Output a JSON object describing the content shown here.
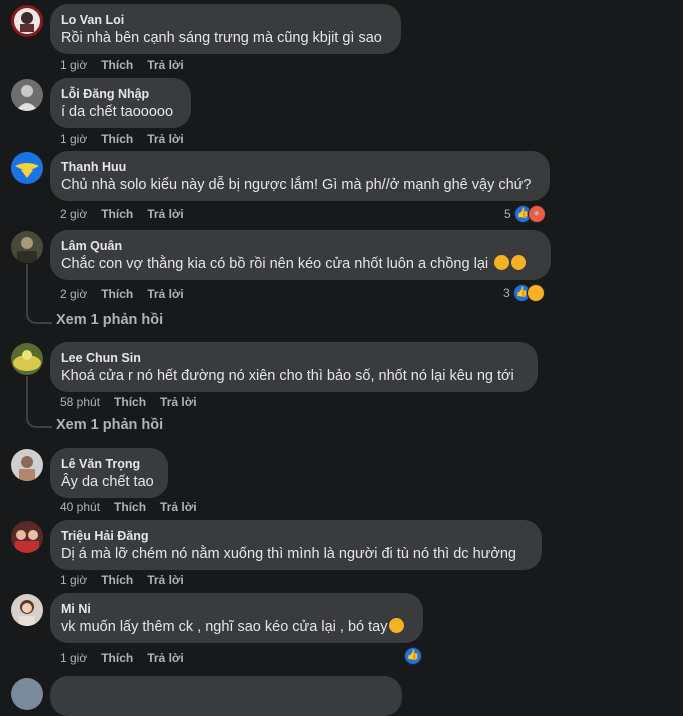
{
  "labels": {
    "like": "Thích",
    "reply": "Trả lời"
  },
  "comments": [
    {
      "author": "Lo Van Loi",
      "text": "Rồi nhà bên cạnh sáng trưng mà cũng kbjit gì sao",
      "time": "1 giờ"
    },
    {
      "author": "Lỗi Đăng Nhập",
      "text": "í da chết taooooo",
      "time": "1 giờ"
    },
    {
      "author": "Thanh Huu",
      "text": "Chủ nhà solo kiểu này dễ bị ngược lắm! Gì mà ph//ở mạnh ghê vậy chứ?",
      "time": "2 giờ",
      "reaction_count": "5"
    },
    {
      "author": "Lâm Quân",
      "text": "Chắc con vợ thằng kia có bồ rồi nên kéo cửa nhốt luôn a chồng lại",
      "time": "2 giờ",
      "reaction_count": "3",
      "replies": "Xem 1 phản hồi"
    },
    {
      "author": "Lee Chun Sin",
      "text": "Khoá cửa r nó hết đường nó xiên cho thì bảo số, nhốt nó lại kêu ng tới",
      "time": "58 phút",
      "replies": "Xem 1 phản hồi"
    },
    {
      "author": "Lê Văn Trọng",
      "text": "Ây da chết tao",
      "time": "40 phút"
    },
    {
      "author": "Triệu Hải Đăng",
      "text": "Dị á mà lỡ chém nó nằm xuống thì mình là người đi tù nó thì dc hưởng",
      "time": "1 giờ"
    },
    {
      "author": "Mi Ni",
      "text": "vk muốn lấy thêm ck , nghĩ sao kéo cửa lại , bó tay",
      "time": "1 giờ"
    }
  ],
  "colors": {
    "background": "#18191a",
    "bubble": "#3a3b3c",
    "like": "#1b74e4",
    "angry": "#f15b43",
    "haha": "#f7b125"
  }
}
